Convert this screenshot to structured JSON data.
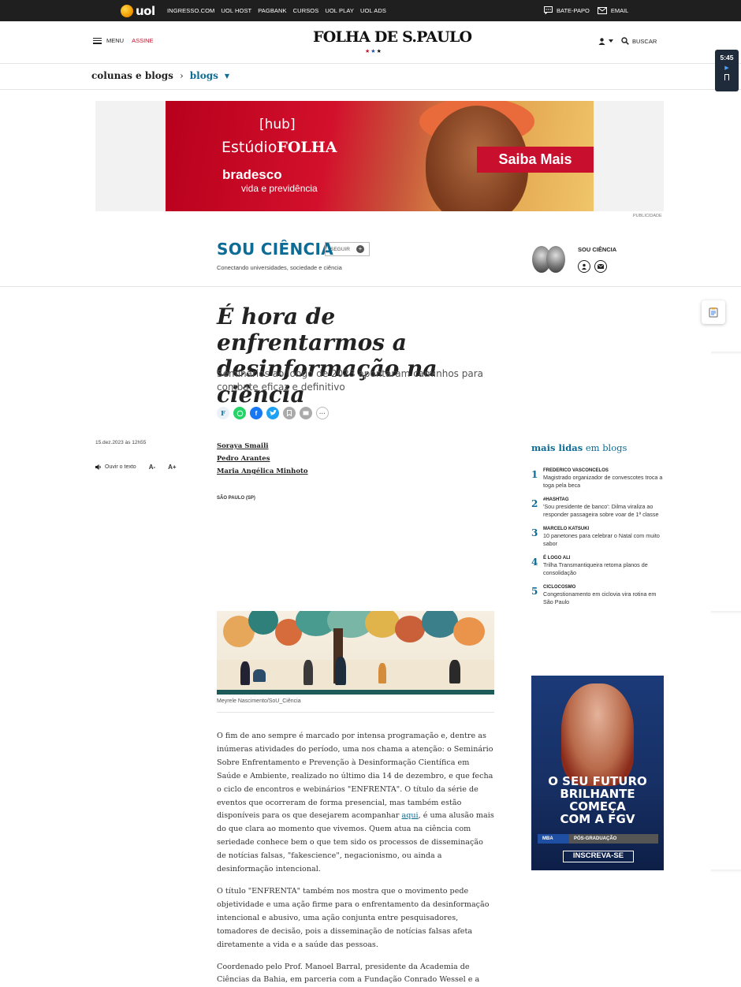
{
  "uol_bar": {
    "logo_text": "uol",
    "links": [
      "INGRESSO.COM",
      "UOL HOST",
      "PAGBANK",
      "CURSOS",
      "UOL PLAY",
      "UOL ADS"
    ],
    "bate_papo": "BATE-PAPO",
    "email": "EMAIL"
  },
  "header": {
    "menu_label": "MENU",
    "assine_label": "ASSINE",
    "logo_text": "FOLHA DE S.PAULO",
    "search_label": "BUSCAR"
  },
  "breadcrumb": {
    "section": "colunas e blogs",
    "separator": "›",
    "current": "blogs"
  },
  "timer": {
    "time": "5:45"
  },
  "ad_banner": {
    "hub": "[hub]",
    "estudio": "Estúdio",
    "folha": "FOLHA",
    "brand": "bradesco",
    "brand_sub": "vida e previdência",
    "cta": "Saiba Mais",
    "publicidade": "PUBLICIDADE"
  },
  "blog": {
    "name": "SOU CIÊNCIA",
    "seguir": "SEGUIR",
    "tagline": "Conectando universidades, sociedade e ciência",
    "author_label": "SOU CIÊNCIA"
  },
  "article": {
    "headline": "É hora de enfrentarmos a desinformação na ciência",
    "subhead": "Seminários ao longo de 2023 apontaram caminhos para combate eficaz e definitivo",
    "date": "15.dez.2023 às 12h55",
    "ouvir": "Ouvir o texto",
    "font_decrease": "A-",
    "font_increase": "A+",
    "authors": [
      "Soraya Smaili",
      "Pedro Arantes",
      "Maria Angélica Minhoto"
    ],
    "location": "SÃO PAULO (SP)",
    "image_caption": "Meyrele Nascimento/SoU_Ciência",
    "paragraphs": [
      {
        "before_link": "O fim de ano sempre é marcado por intensa programação e, dentre as inúmeras atividades do período, uma nos chama a atenção: o Seminário Sobre Enfrentamento e Prevenção à Desinformação Científica em Saúde e Ambiente, realizado no último dia 14 de dezembro, e que fecha o ciclo de encontros e webinários \"ENFRENTA\". O título da série de eventos que ocorreram de forma presencial, mas também estão disponíveis para os que desejarem acompanhar ",
        "link": "aqui",
        "after_link": ", é uma alusão mais do que clara ao momento que vivemos. Quem atua na ciência com seriedade conhece bem o que tem sido os processos de disseminação de notícias falsas, \"fakescience\", negacionismo, ou ainda a desinformação intencional."
      },
      {
        "text": "O título \"ENFRENTA\" também nos mostra que o movimento pede objetividade e uma ação firme para o enfrentamento da desinformação intencional e abusivo, uma ação conjunta entre pesquisadores, tomadores de decisão, pois a disseminação de notícias falsas afeta diretamente a vida e a saúde das pessoas."
      },
      {
        "text": "Coordenado pelo Prof. Manoel Barral, presidente da Academia de Ciências da Bahia, em parceria com a Fundação Conrado Wessel e a"
      }
    ]
  },
  "mais_lidas": {
    "title_bold": "mais lidas",
    "title_rest": "em blogs",
    "items": [
      {
        "num": "1",
        "category": "FREDERICO VASCONCELOS",
        "title": "Magistrado organizador de convescotes troca a toga pela beca"
      },
      {
        "num": "2",
        "category": "#HASHTAG",
        "title": "'Sou presidente de banco': Dilma viraliza ao responder passageira sobre voar de 1ª classe"
      },
      {
        "num": "3",
        "category": "MARCELO KATSUKI",
        "title": "10 panetones para celebrar o Natal com muito sabor"
      },
      {
        "num": "4",
        "category": "É LOGO ALI",
        "title": "Trilha Transmantiqueira retoma planos de consolidação"
      },
      {
        "num": "5",
        "category": "CICLOCOSMO",
        "title": "Congestionamento em ciclovia vira rotina em São Paulo"
      }
    ]
  },
  "side_ad": {
    "line1": "O SEU FUTURO",
    "line2": "BRILHANTE",
    "line3": "COMEÇA",
    "line4": "COM A FGV",
    "mba": "MBA",
    "pos": "PÓS-GRADUAÇÃO",
    "cta": "INSCREVA-SE"
  },
  "colors": {
    "brand_blue": "#0d6c96",
    "assine_red": "#c8102e",
    "top_bar": "#1f1f1f"
  }
}
